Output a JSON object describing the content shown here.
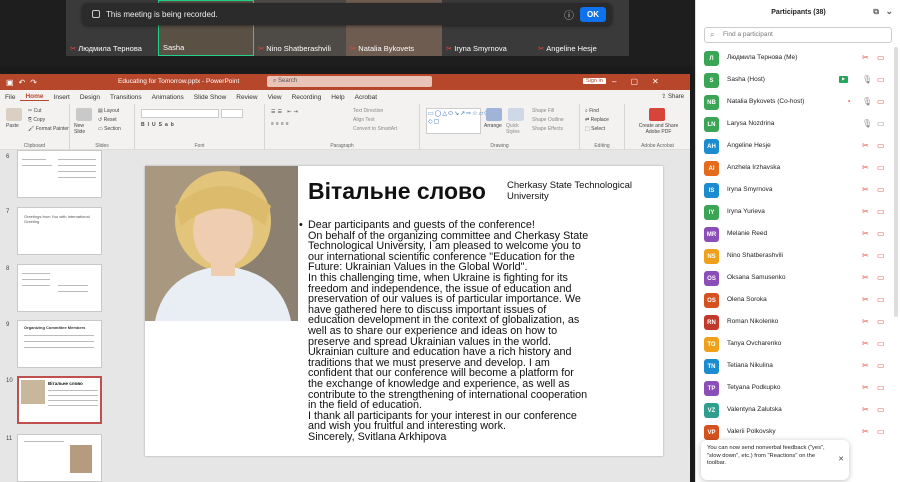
{
  "banner": {
    "text": "This meeting is being recorded.",
    "ok": "OK"
  },
  "tiles": [
    {
      "name": "Людмила Тернова"
    },
    {
      "name": "Sasha"
    },
    {
      "name": "Nino Shatberashvili"
    },
    {
      "name": "Natalia Bykovets"
    },
    {
      "name": "Iryna Smyrnova"
    },
    {
      "name": "Angeline Hesje"
    }
  ],
  "ppt": {
    "window_title": "Educating for Tomorrow.pptx - PowerPoint",
    "search": "Search",
    "signin": "Sign in",
    "share": "Share",
    "menus": [
      "File",
      "Home",
      "Insert",
      "Design",
      "Transitions",
      "Animations",
      "Slide Show",
      "Review",
      "View",
      "Recording",
      "Help",
      "Acrobat"
    ],
    "ribbon": {
      "clipboard": "Clipboard",
      "paste": "Paste",
      "cut": "Cut",
      "copy": "Copy",
      "format_painter": "Format Painter",
      "slides": "Slides",
      "new_slide": "New Slide",
      "layout": "Layout",
      "reset": "Reset",
      "section": "Section",
      "font": "Font",
      "paragraph": "Paragraph",
      "text_direction": "Text Direction",
      "align_text": "Align Text",
      "convert_smartart": "Convert to SmartArt",
      "drawing": "Drawing",
      "arrange": "Arrange",
      "quick_styles": "Quick Styles",
      "shape_fill": "Shape Fill",
      "shape_outline": "Shape Outline",
      "shape_effects": "Shape Effects",
      "editing": "Editing",
      "find": "Find",
      "replace": "Replace",
      "select": "Select",
      "adobe": "Adobe Acrobat",
      "create_share": "Create and Share Adobe PDF"
    },
    "thumbs": [
      {
        "num": "6"
      },
      {
        "num": "7",
        "text": "Greetings from You with International Greeting"
      },
      {
        "num": "8"
      },
      {
        "num": "9",
        "text": "Organizing Committee Members"
      },
      {
        "num": "10",
        "text": "Вітальне слово"
      },
      {
        "num": "11"
      }
    ],
    "slide": {
      "title": "Вітальне слово",
      "subtitle": "Cherkasy State Technological University",
      "bullet": "•",
      "lines": [
        "Dear participants and guests of the conference!",
        "On behalf of the organizing committee and Cherkasy State",
        "Technological University, I am pleased to welcome you to",
        "our international scientific conference \"Education for the",
        "Future: Ukrainian Values in the Global World\".",
        "In this challenging time, when Ukraine is fighting for its",
        "freedom and independence, the issue of education and",
        "preservation of our values is of particular importance. We",
        "have gathered here to discuss important issues of",
        "education development in the context of globalization, as",
        "well as to share our experience and ideas on how to",
        "preserve and spread Ukrainian values in the world.",
        "Ukrainian culture and education have a rich history and",
        "traditions that we must preserve and develop. I am",
        "confident that our conference will become a platform for",
        "the exchange of knowledge and experience, as well as",
        "contribute to the strengthening of international cooperation",
        "in the field of education.",
        "I thank all participants for your interest in our conference",
        "and wish you fruitful and interesting work.",
        "Sincerely, Svitlana Arkhipova"
      ]
    }
  },
  "participants": {
    "title": "Participants (38)",
    "find_placeholder": "Find a participant",
    "list": [
      {
        "initials": "Л",
        "name": "Людмила Тернова (Me)",
        "color": "#3aa655"
      },
      {
        "initials": "S",
        "name": "Sasha (Host)",
        "color": "#3aa655"
      },
      {
        "initials": "NB",
        "name": "Natalia Bykovets (Co-host)",
        "color": "#3aa655"
      },
      {
        "initials": "LN",
        "name": "Larysa Nozdrina",
        "color": "#3aa655"
      },
      {
        "initials": "AH",
        "name": "Angeline Hesje",
        "color": "#1a8ccf"
      },
      {
        "initials": "AI",
        "name": "Anzhela Irzhavska",
        "color": "#e46b1c"
      },
      {
        "initials": "IS",
        "name": "Iryna Smyrnova",
        "color": "#1a8ccf"
      },
      {
        "initials": "IY",
        "name": "Iryna Yurieva",
        "color": "#3aa655"
      },
      {
        "initials": "MR",
        "name": "Melanie Reed",
        "color": "#8b4db8"
      },
      {
        "initials": "NS",
        "name": "Nino Shatberashvili",
        "color": "#f0a11b"
      },
      {
        "initials": "OS",
        "name": "Oksana Samusenko",
        "color": "#8b4db8"
      },
      {
        "initials": "OS",
        "name": "Olena Soroka",
        "color": "#d4521f"
      },
      {
        "initials": "RN",
        "name": "Roman Nikolenko",
        "color": "#c0392b"
      },
      {
        "initials": "TO",
        "name": "Tanya Ovcharenko",
        "color": "#f0a11b"
      },
      {
        "initials": "TN",
        "name": "Tetiana Nikulina",
        "color": "#1a8ccf"
      },
      {
        "initials": "TP",
        "name": "Tetyana Podkupko",
        "color": "#8b4db8"
      },
      {
        "initials": "VZ",
        "name": "Valentyna Zalutska",
        "color": "#2e9e8e"
      },
      {
        "initials": "VP",
        "name": "Valerii Polkovsky",
        "color": "#d4521f"
      }
    ],
    "toast": "You can now send nonverbal feedback (\"yes\", \"slow down\", etc.) from \"Reactions\" on the toolbar."
  }
}
